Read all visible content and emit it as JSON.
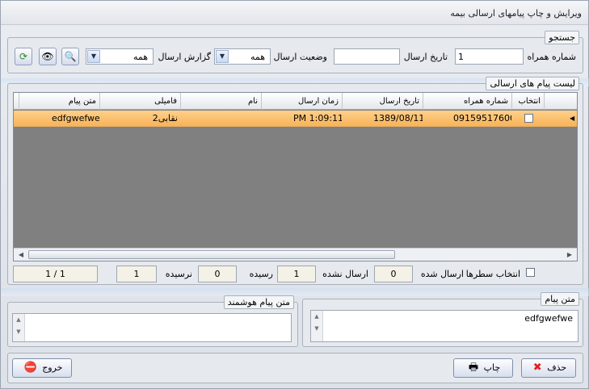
{
  "window": {
    "title": "ویرایش و چاپ  پیامهای ارسالی  بیمه"
  },
  "search": {
    "legend": "جستجو",
    "mobile_label": "شماره همراه",
    "mobile_value": "1",
    "send_date_label": "تاریخ ارسال",
    "send_date_value": "",
    "send_status_label": "وضعیت ارسال",
    "send_status_value": "همه",
    "send_report_label": "گزارش ارسال",
    "send_report_value": "همه"
  },
  "list": {
    "legend": "لیست پیام های ارسالی",
    "columns": {
      "select": "انتخاب",
      "mobile": "شماره همراه",
      "send_date": "تاریخ ارسال",
      "send_time": "زمان ارسال",
      "name": "نام",
      "family": "فامیلی",
      "message": "متن پیام"
    },
    "rows": [
      {
        "mobile": "09159517600",
        "send_date": "1389/08/11",
        "send_time": "PM 1:09:11",
        "name": "",
        "family": "نقابی2",
        "message": "edfgwefwe"
      }
    ]
  },
  "stats": {
    "select_rows_label": "انتخاب سطرها",
    "sent_label": "ارسال شده",
    "sent_value": "0",
    "not_sent_label": "ارسال نشده",
    "not_sent_value": "1",
    "received_label": "رسیده",
    "received_value": "0",
    "not_received_label": "نرسیده",
    "not_received_value": "1",
    "page_indicator": "1 / 1"
  },
  "message": {
    "legend": "متن پیام",
    "value": "edfgwefwe"
  },
  "smart_message": {
    "legend": "متن پیام هوشمند",
    "value": ""
  },
  "buttons": {
    "delete": "حذف",
    "print": "چاپ",
    "exit": "خروج"
  },
  "colors": {
    "selected_row": "#f7b257",
    "grid_background": "#808080"
  }
}
